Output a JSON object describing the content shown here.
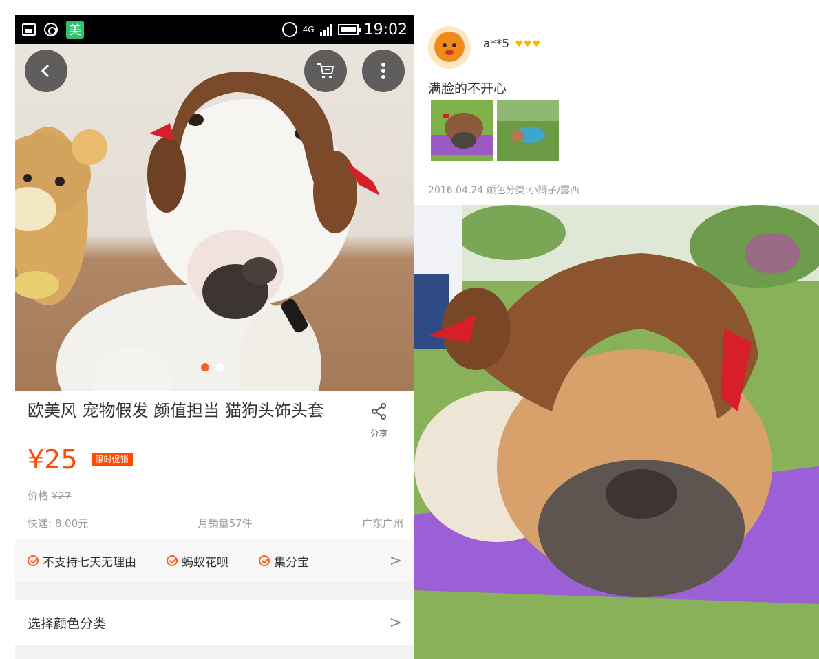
{
  "status_bar": {
    "mei_label": "美",
    "network": "4G",
    "time": "19:02"
  },
  "product": {
    "title": "欧美风 宠物假发 颜值担当 猫狗头饰头套",
    "share_label": "分享",
    "price": "¥25",
    "promo_badge": "限时促销",
    "original_price_label": "价格",
    "original_price": "¥27",
    "shipping": "快递: 8.00元",
    "monthly_sales": "月销量57件",
    "location": "广东广州",
    "image_dots": 2,
    "active_dot": 0
  },
  "services": {
    "items": [
      "不支持七天无理由",
      "蚂蚁花呗",
      "集分宝"
    ],
    "chevron": ">"
  },
  "selection": {
    "label": "选择颜色分类",
    "chevron": ">"
  },
  "review": {
    "username": "a**5",
    "level_icons": "♥♥♥",
    "text": "满脸的不开心",
    "meta": "2016.04.24 颜色分类:小辫子/露西"
  },
  "icons": {
    "back": "chevron-left-icon",
    "cart": "cart-icon",
    "more": "more-vertical-icon",
    "share": "share-icon"
  },
  "colors": {
    "accent": "#ff4a00",
    "status_bar": "#000000"
  }
}
